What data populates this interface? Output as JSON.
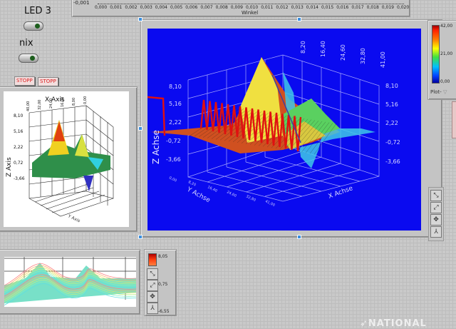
{
  "top_graph": {
    "x_ticks": [
      "0,000",
      "0,001",
      "0,002",
      "0,003",
      "0,004",
      "0,005",
      "0,006",
      "0,007",
      "0,008",
      "0,009",
      "0,010",
      "0,011",
      "0,012",
      "0,013",
      "0,014",
      "0,015",
      "0,016",
      "0,017",
      "0,018",
      "0,019",
      "0,020"
    ],
    "y_tick": "-0,001",
    "x_label": "Winkel"
  },
  "leds": [
    {
      "label": "LED 3"
    },
    {
      "label": "nix"
    }
  ],
  "stop_buttons": [
    {
      "label": "STOPP"
    },
    {
      "label": "STOPP"
    }
  ],
  "small_graph": {
    "x_axis_title": "X Axis",
    "z_axis_title": "Z Axis",
    "y_axis_title": "Y Axis",
    "z_ticks": [
      "8,10",
      "5,16",
      "2,22",
      "0,72",
      "-3,66"
    ],
    "x_ticks": [
      "40,00",
      "32,00",
      "24,00",
      "16,00",
      "8,00",
      "0,00"
    ]
  },
  "main_graph": {
    "z_axis_title": "Z Achse",
    "y_axis_title": "Y Achse",
    "x_axis_title": "X Achse",
    "z_ticks": [
      "8,10",
      "5,16",
      "2,22",
      "-0,72",
      "-3,66"
    ],
    "top_ticks": [
      "8,20",
      "16,40",
      "24,60",
      "32,80",
      "41,00"
    ],
    "y_ticks": [
      "0,00",
      "8,20",
      "16,40",
      "24,60",
      "32,80",
      "41,00"
    ],
    "background": "#0a0af0"
  },
  "colorbar": {
    "max": "42,00",
    "mid": "21,00",
    "min": "0,00",
    "plot_selector": "Plot-"
  },
  "bottom_colorbar": {
    "max": "8,05",
    "mid": "0,75",
    "min": "-6,55"
  },
  "logo": "NATIONAL"
}
